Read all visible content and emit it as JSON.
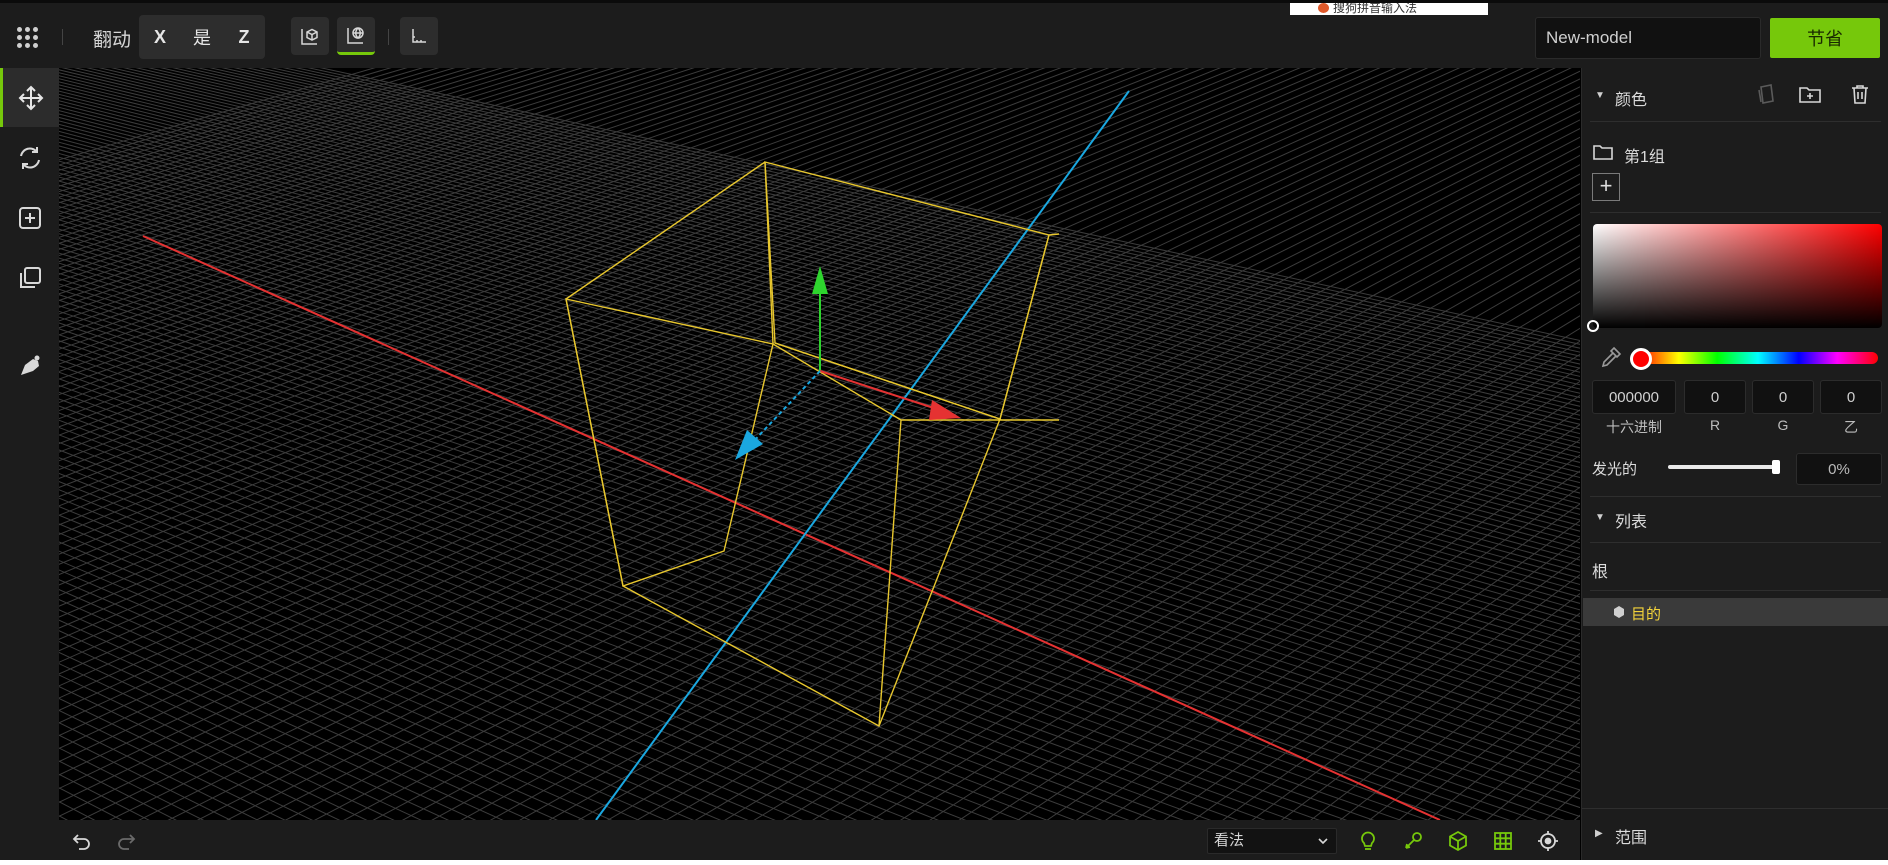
{
  "topbar": {
    "transform_label": "翻动",
    "axes": [
      "X",
      "是",
      "Z"
    ],
    "ime_text": "搜狗拼音输入法",
    "model_name": "New-model",
    "save_label": "节省"
  },
  "viewport": {
    "view_mode": "看法"
  },
  "panel": {
    "color_title": "颜色",
    "group_name": "第1组",
    "add_symbol": "+",
    "hex_value": "000000",
    "r_value": "0",
    "g_value": "0",
    "b_value": "0",
    "hex_label": "十六进制",
    "r_label": "R",
    "g_label": "G",
    "b_label": "乙",
    "glow_label": "发光的",
    "glow_value": "0%",
    "list_title": "列表",
    "root_label": "根",
    "selected_item": "目的",
    "range_title": "范围"
  },
  "colors": {
    "accent": "#76c80b",
    "x_axis": "#e53232",
    "y_axis": "#2ed52e",
    "z_axis": "#1aa7e0",
    "selection": "#f3d33a"
  },
  "icons": {
    "left_tools": [
      "move-icon",
      "rotate-icon",
      "add-object-icon",
      "duplicate-icon",
      "paint-icon"
    ],
    "bottom_tools": [
      "undo-icon",
      "redo-icon",
      "light-icon",
      "brush-icon",
      "cube-icon",
      "grid-icon",
      "target-icon"
    ]
  }
}
